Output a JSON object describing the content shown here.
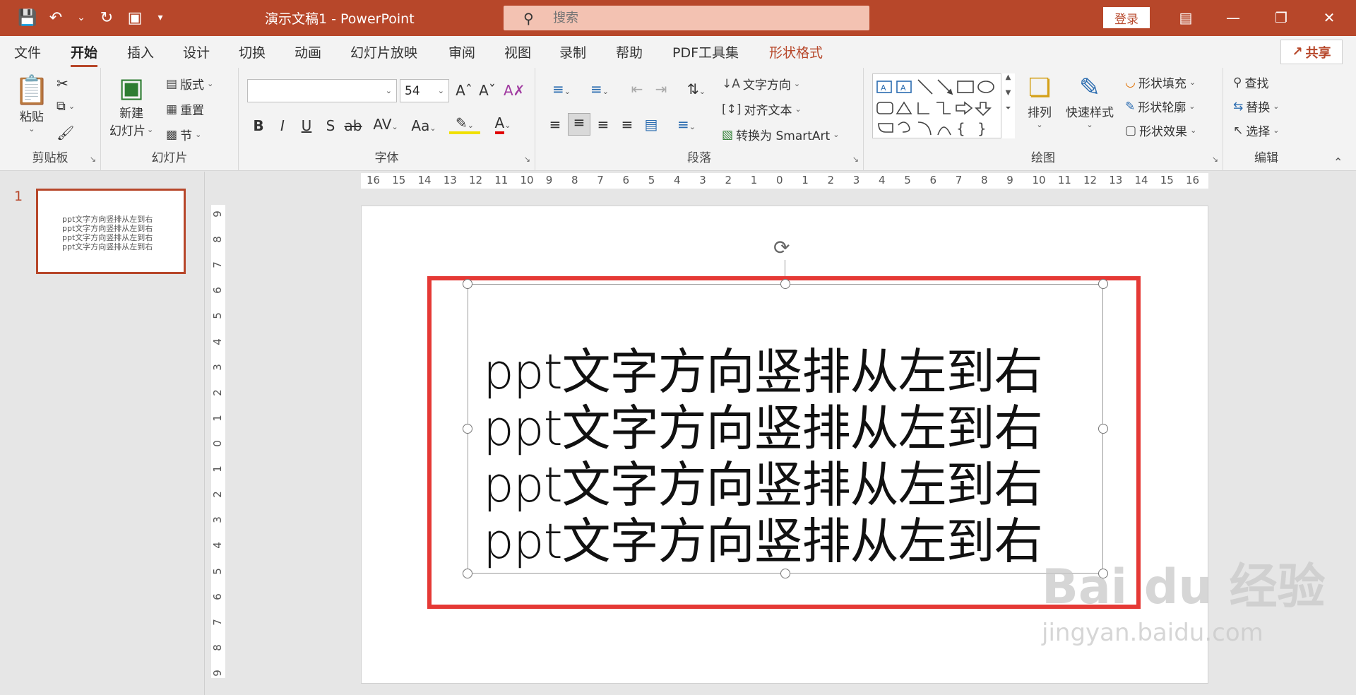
{
  "window": {
    "doc_title": "演示文稿1  -  PowerPoint",
    "search_placeholder": "搜索",
    "login_label": "登录",
    "share_label": "共享",
    "accent": "#b7472a"
  },
  "tabs": [
    {
      "label": "文件"
    },
    {
      "label": "开始"
    },
    {
      "label": "插入"
    },
    {
      "label": "设计"
    },
    {
      "label": "切换"
    },
    {
      "label": "动画"
    },
    {
      "label": "幻灯片放映"
    },
    {
      "label": "审阅"
    },
    {
      "label": "视图"
    },
    {
      "label": "录制"
    },
    {
      "label": "帮助"
    },
    {
      "label": "PDF工具集"
    },
    {
      "label": "形状格式"
    }
  ],
  "ribbon": {
    "clipboard": {
      "label": "剪贴板",
      "paste": "粘贴"
    },
    "slides": {
      "label": "幻灯片",
      "new_slide_1": "新建",
      "new_slide_2": "幻灯片",
      "layout": "版式",
      "reset": "重置",
      "section": "节"
    },
    "font": {
      "label": "字体",
      "font_name": "",
      "font_size": "54"
    },
    "paragraph": {
      "label": "段落",
      "text_direction": "文字方向",
      "align_text": "对齐文本",
      "smartart": "转换为 SmartArt"
    },
    "drawing": {
      "label": "绘图",
      "arrange": "排列",
      "quick_styles": "快速样式",
      "shape_fill": "形状填充",
      "shape_outline": "形状轮廓",
      "shape_effects": "形状效果"
    },
    "editing": {
      "label": "编辑",
      "find": "查找",
      "replace": "替换",
      "select": "选择"
    }
  },
  "thumbnail": {
    "number": "1",
    "lines": [
      "ppt文字方向竖排从左到右",
      "ppt文字方向竖排从左到右",
      "ppt文字方向竖排从左到右",
      "ppt文字方向竖排从左到右"
    ]
  },
  "slide": {
    "lines": [
      "ppt文字方向竖排从左到右",
      "ppt文字方向竖排从左到右",
      "ppt文字方向竖排从左到右",
      "ppt文字方向竖排从左到右"
    ]
  },
  "ruler": {
    "h_ticks": [
      "16",
      "15",
      "14",
      "13",
      "12",
      "11",
      "10",
      "9",
      "8",
      "7",
      "6",
      "5",
      "4",
      "3",
      "2",
      "1",
      "0",
      "1",
      "2",
      "3",
      "4",
      "5",
      "6",
      "7",
      "8",
      "9",
      "10",
      "11",
      "12",
      "13",
      "14",
      "15",
      "16"
    ],
    "v_ticks": [
      "9",
      "8",
      "7",
      "6",
      "5",
      "4",
      "3",
      "2",
      "1",
      "0",
      "1",
      "2",
      "3",
      "4",
      "5",
      "6",
      "7",
      "8",
      "9"
    ]
  },
  "watermark": {
    "big": "Bai du 经验",
    "small": "jingyan.baidu.com"
  }
}
